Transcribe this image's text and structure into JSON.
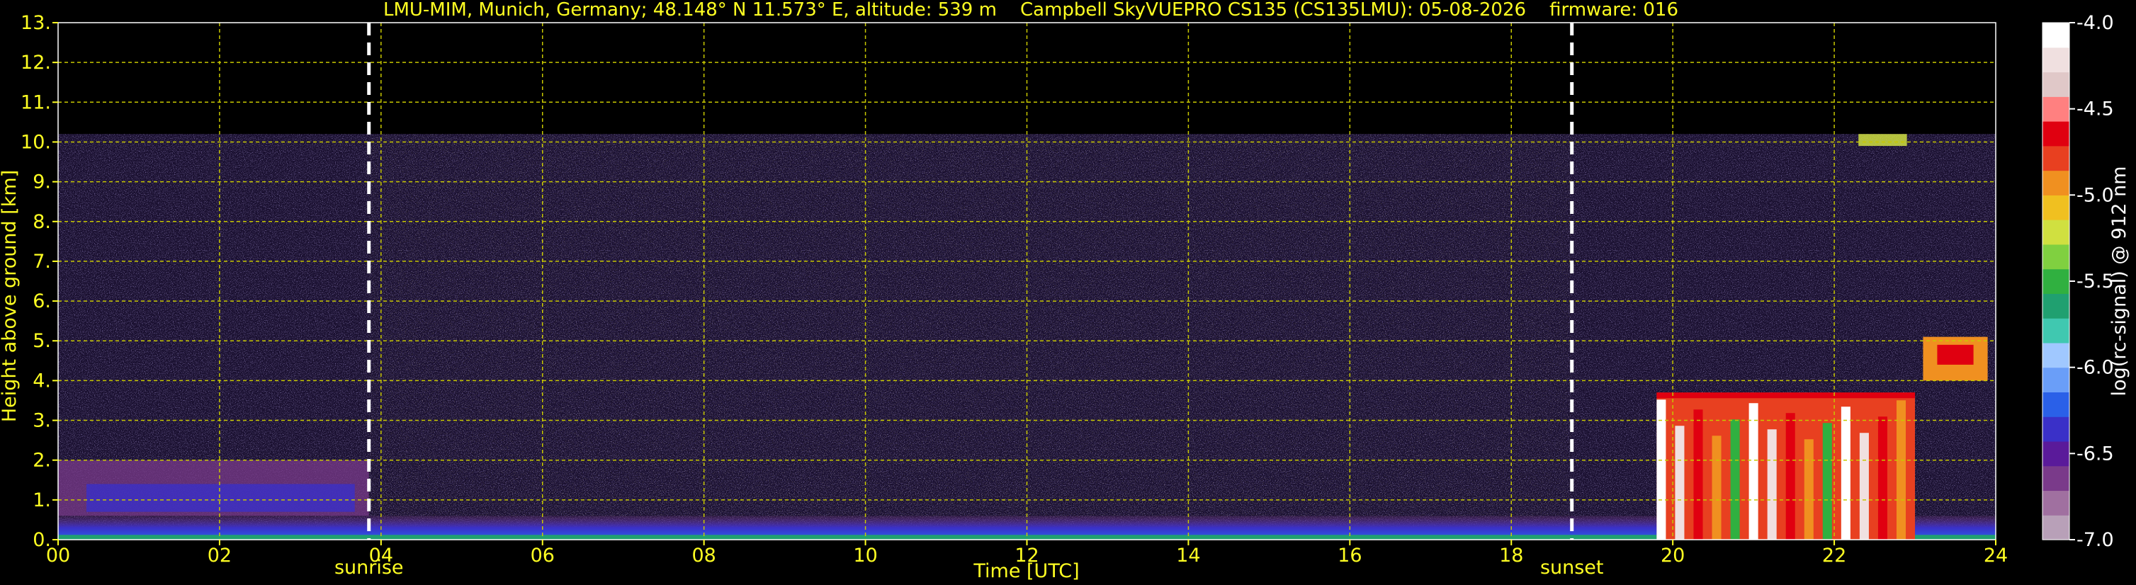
{
  "chart_data": {
    "type": "heatmap",
    "title": "LMU-MIM, Munich, Germany; 48.148° N 11.573° E, altitude: 539 m    Campbell SkyVUEPRO CS135 (CS135LMU): 05-08-2026    firmware: 016",
    "xlabel": "Time [UTC]",
    "ylabel": "Height above ground [km]",
    "xlim": [
      0,
      24
    ],
    "ylim": [
      0,
      13
    ],
    "x_ticks": [
      "00",
      "02",
      "04",
      "06",
      "08",
      "10",
      "12",
      "14",
      "16",
      "18",
      "20",
      "22",
      "24"
    ],
    "y_ticks": [
      "0.",
      "1.",
      "2.",
      "3.",
      "4.",
      "5.",
      "6.",
      "7.",
      "8.",
      "9.",
      "10.",
      "11.",
      "12.",
      "13."
    ],
    "grid": true,
    "events": [
      {
        "label": "sunrise",
        "time": 3.85
      },
      {
        "label": "sunset",
        "time": 18.75
      }
    ],
    "colorbar": {
      "label": "log(rc-signal) @ 912 nm",
      "range": [
        -7.0,
        -4.0
      ],
      "ticks": [
        "-4.0",
        "-4.5",
        "-5.0",
        "-5.5",
        "-6.0",
        "-6.5",
        "-7.0"
      ]
    },
    "features": [
      {
        "kind": "boundary_layer",
        "start": 0,
        "end": 24,
        "height_top": 0.6
      },
      {
        "kind": "residual_layer",
        "start": 0,
        "end": 3.85,
        "height_top": 2.0
      },
      {
        "kind": "noise_region",
        "start": 0,
        "end": 24,
        "height_top": 10.2
      },
      {
        "kind": "low_cloud",
        "start": 19.8,
        "end": 23.0,
        "height_top": 3.7
      },
      {
        "kind": "mid_cloud",
        "start": 23.1,
        "end": 23.9,
        "height_top": 5.1
      },
      {
        "kind": "cirrus",
        "start": 22.3,
        "end": 22.9,
        "height_top": 10.2
      }
    ]
  },
  "colors": {
    "text": "#ffff22",
    "grid": "#c8c800",
    "background": "#000000",
    "colormap": [
      "#b8a0b8",
      "#a070a0",
      "#7a3a8a",
      "#5a1a9a",
      "#3a30c8",
      "#2a60e8",
      "#6a9ef8",
      "#a0c8ff",
      "#40c8b0",
      "#20a070",
      "#30b040",
      "#80d040",
      "#d0e040",
      "#f0c020",
      "#f09020",
      "#e84020",
      "#e00010",
      "#ff8080",
      "#e0c8c8",
      "#f0e0e0",
      "#ffffff"
    ]
  }
}
